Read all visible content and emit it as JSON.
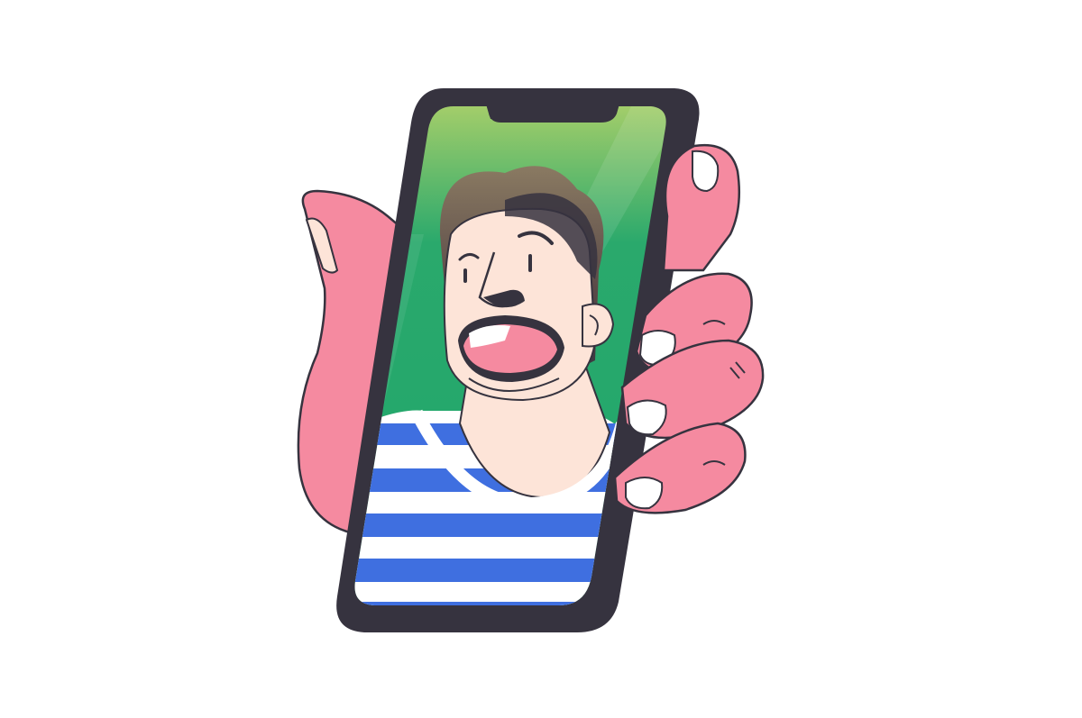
{
  "scene": {
    "subject": "hand-holding-phone-video-call",
    "icons": [
      "hand-icon",
      "smartphone-icon",
      "person-avatar-icon"
    ]
  },
  "colors": {
    "background": "#ffffff",
    "outline": "#36333f",
    "phone_body": "#36333f",
    "skin_hand": "#f58aa0",
    "skin_face": "#fde4d8",
    "screen_top": "#a9cf6a",
    "screen_main": "#1fa66b",
    "hair": "#36333f",
    "shirt_blue": "#3f6fe0",
    "shirt_white": "#ffffff",
    "mouth": "#f58aa0",
    "nail": "#ffffff"
  }
}
